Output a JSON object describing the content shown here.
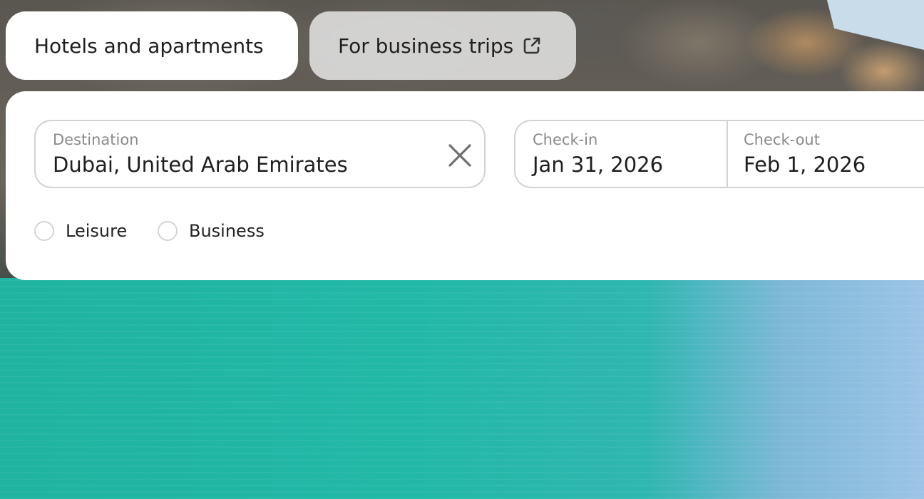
{
  "tabs": [
    {
      "label": "Hotels and apartments",
      "active": true
    },
    {
      "label": "For business trips",
      "active": false,
      "icon": "external-link-icon"
    }
  ],
  "search": {
    "destination": {
      "label": "Destination",
      "value": "Dubai, United Arab Emirates",
      "clear_icon": "close-icon"
    },
    "check_in": {
      "label": "Check-in",
      "value": "Jan 31, 2026"
    },
    "check_out": {
      "label": "Check-out",
      "value": "Feb 1, 2026"
    }
  },
  "trip_type": {
    "options": [
      {
        "label": "Leisure",
        "selected": false
      },
      {
        "label": "Business",
        "selected": false
      }
    ]
  },
  "colors": {
    "card_background": "#ffffff",
    "inactive_tab_background": "#e1e1e1",
    "field_border": "#d2d2d2",
    "label_text": "#8a8a8a",
    "value_text": "#1f1f1f"
  }
}
